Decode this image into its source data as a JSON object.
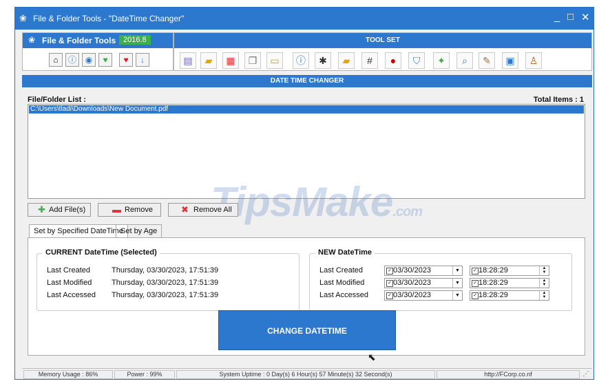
{
  "window": {
    "title": "File & Folder Tools - \"DateTime Changer\"",
    "minimize_glyph": "_",
    "maximize_glyph": "□",
    "close_glyph": "✕"
  },
  "brand": {
    "name": "File & Folder Tools",
    "version": "2016.8"
  },
  "toolset": {
    "header": "TOOL SET"
  },
  "section": {
    "title": "DATE TIME CHANGER"
  },
  "file_list": {
    "label": "File/Folder List :",
    "total_label": "Total Items : 1",
    "items": [
      "C:\\Users\\tladi\\Downloads\\New Document.pdf"
    ]
  },
  "actions": {
    "add_label": "Add File(s)",
    "remove_label": "Remove",
    "remove_all_label": "Remove All"
  },
  "tabs": [
    {
      "label": "Set by Specified DateTime",
      "active": true
    },
    {
      "label": "Set by Age",
      "active": false
    }
  ],
  "current": {
    "title": "CURRENT DateTime (Selected)",
    "rows": [
      {
        "label": "Last Created",
        "value": "Thursday, 03/30/2023, 17:51:39"
      },
      {
        "label": "Last Modified",
        "value": "Thursday, 03/30/2023, 17:51:39"
      },
      {
        "label": "Last Accessed",
        "value": "Thursday, 03/30/2023, 17:51:39"
      }
    ]
  },
  "new": {
    "title": "NEW DateTime",
    "rows": [
      {
        "label": "Last Created",
        "date": "03/30/2023",
        "time": "18:28:29"
      },
      {
        "label": "Last Modified",
        "date": "03/30/2023",
        "time": "18:28:29"
      },
      {
        "label": "Last Accessed",
        "date": "03/30/2023",
        "time": "18:28:29"
      }
    ]
  },
  "change_button": "CHANGE DATETIME",
  "statusbar": {
    "memory": "Memory Usage : 86%",
    "power": "Power : 99%",
    "uptime": "System Uptime : 0 Day(s) 6 Hour(s) 57 Minute(s) 32 Second(s)",
    "url": "http://FCorp.co.nf"
  },
  "watermark": {
    "main": "TipsMake",
    "suffix": ".com"
  },
  "colors": {
    "accent": "#2d78cf",
    "version_badge": "#3cb04a"
  },
  "icons": {
    "brand_small": [
      "home-icon",
      "info-icon",
      "broadcast-icon",
      "heart-check-icon",
      "heart-icon",
      "download-icon"
    ],
    "tools": [
      "notepad-icon",
      "folder-add-icon",
      "calendar-icon",
      "copy-icon",
      "document-icon",
      "info-icon",
      "bug-icon",
      "folder-icon",
      "hash-icon",
      "virus-icon",
      "shield-icon",
      "walker-icon",
      "search-icon",
      "pen-icon",
      "image-icon",
      "user-icon"
    ]
  }
}
